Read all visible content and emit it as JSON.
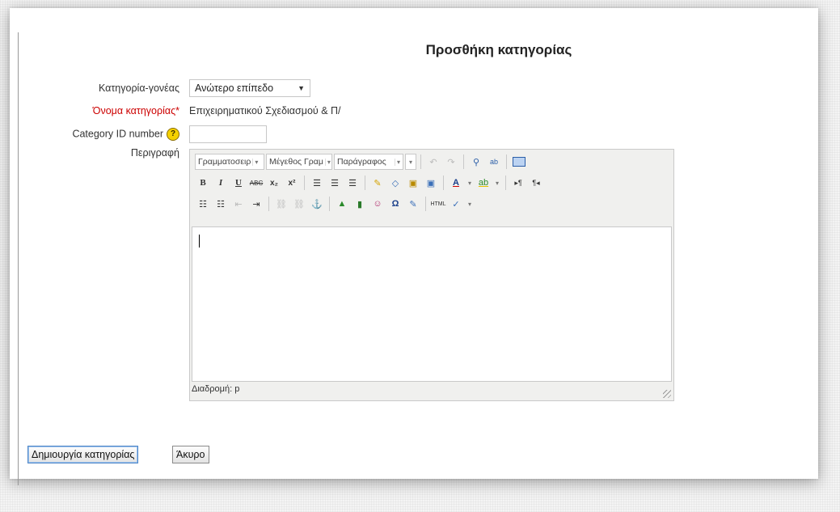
{
  "page_title": "Προσθήκη κατηγορίας",
  "form": {
    "parent_label": "Κατηγορία-γονέας",
    "parent_value": "Ανώτερο επίπεδο",
    "name_label": "Όνομα κατηγορίας",
    "name_required_mark": "*",
    "name_value": "Επιχειρηματικού Σχεδιασμού & Π/",
    "idnumber_label": "Category ID number",
    "idnumber_help": "?",
    "idnumber_value": "",
    "description_label": "Περιγραφή"
  },
  "editor": {
    "font_family": "Γραμματοσειρ",
    "font_size": "Μέγεθος Γραμ",
    "format": "Παράγραφος",
    "row1_icons": [
      "undo-icon",
      "redo-icon",
      "find-icon",
      "replace-icon",
      "fullscreen-icon"
    ],
    "row2_icons": [
      "bold-icon",
      "italic-icon",
      "underline-icon",
      "strikethrough-icon",
      "subscript-icon",
      "superscript-icon",
      "align-left-icon",
      "align-center-icon",
      "align-right-icon",
      "cleanup-icon",
      "eraser-icon",
      "paste-text-icon",
      "paste-word-icon",
      "text-color-icon",
      "background-color-icon",
      "ltr-icon",
      "rtl-icon"
    ],
    "row3_icons": [
      "bullet-list-icon",
      "numbered-list-icon",
      "outdent-icon",
      "indent-icon",
      "link-icon",
      "unlink-icon",
      "anchor-icon",
      "image-icon",
      "media-icon",
      "emoticon-icon",
      "special-char-icon",
      "edit-icon",
      "html-icon",
      "spellcheck-icon"
    ],
    "path_label": "Διαδρομή: p"
  },
  "buttons": {
    "submit": "Δημιουργία κατηγορίας",
    "cancel": "Άκυρο"
  }
}
